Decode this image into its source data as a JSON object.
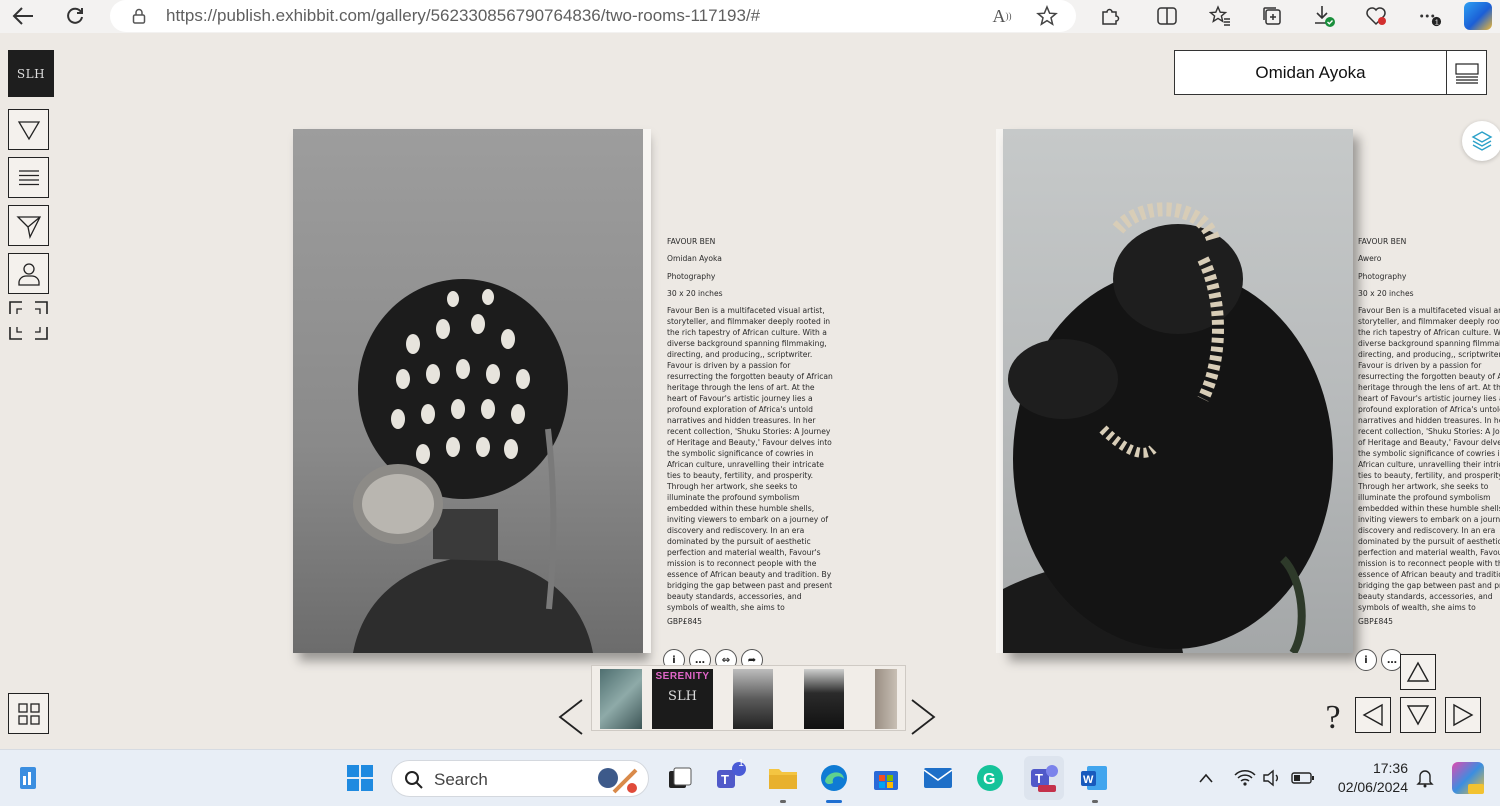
{
  "browser": {
    "url": "https://publish.exhibbit.com/gallery/562330856790764836/two-rooms-117193/#"
  },
  "gallery": {
    "logo_text": "SLH",
    "artist_name": "Omidan Ayoka",
    "left_artwork": {
      "artist": "FAVOUR BEN",
      "title": "Omidan Ayoka",
      "medium": "Photography",
      "size": "30 x 20 inches",
      "description": "Favour Ben is a multifaceted visual artist, storyteller, and filmmaker deeply rooted in the rich tapestry of African culture. With a diverse background spanning filmmaking, directing, and producing,, scriptwriter. Favour is driven by a passion for resurrecting the forgotten beauty of African heritage through the lens of art. At the heart of Favour's artistic journey lies a profound exploration of Africa's untold narratives and hidden treasures. In her recent collection, 'Shuku Stories: A Journey of Heritage and Beauty,' Favour delves into the symbolic significance of cowries in African culture, unravelling their intricate ties to beauty, fertility, and prosperity. Through her artwork, she seeks to illuminate the profound symbolism embedded within these humble shells, inviting viewers to embark on a journey of discovery and rediscovery. In an era dominated by the pursuit of aesthetic perfection and material wealth, Favour's mission is to reconnect people with the essence of African beauty and tradition. By bridging the gap between past and present beauty standards, accessories, and symbols of wealth, she aims to",
      "price": "GBP£845"
    },
    "right_artwork": {
      "artist": "FAVOUR BEN",
      "title": "Awero",
      "medium": "Photography",
      "size": "30 x 20 inches",
      "description": "Favour Ben is a multifaceted visual artist, storyteller, and filmmaker deeply rooted in the rich tapestry of African culture. With a diverse background spanning filmmaking, directing, and producing,, scriptwriter. Favour is driven by a passion for resurrecting the forgotten beauty of African heritage through the lens of art. At the heart of Favour's artistic journey lies a profound exploration of Africa's untold narratives and hidden treasures. In her recent collection, 'Shuku Stories: A Journey of Heritage and Beauty,' Favour delves into the symbolic significance of cowries in African culture, unravelling their intricate ties to beauty, fertility, and prosperity. Through her artwork, she seeks to illuminate the profound symbolism embedded within these humble shells, inviting viewers to embark on a journey of discovery and rediscovery. In an era dominated by the pursuit of aesthetic perfection and material wealth, Favour's mission is to reconnect people with the essence of African beauty and tradition. By bridging the gap between past and present beauty standards, accessories, and symbols of wealth, she aims to",
      "price": "GBP£845"
    },
    "thumbnail_label": "SERENITY",
    "help_label": "?"
  },
  "taskbar": {
    "search_label": "Search",
    "teams_badge": "1",
    "time": "17:36",
    "date": "02/06/2024"
  }
}
